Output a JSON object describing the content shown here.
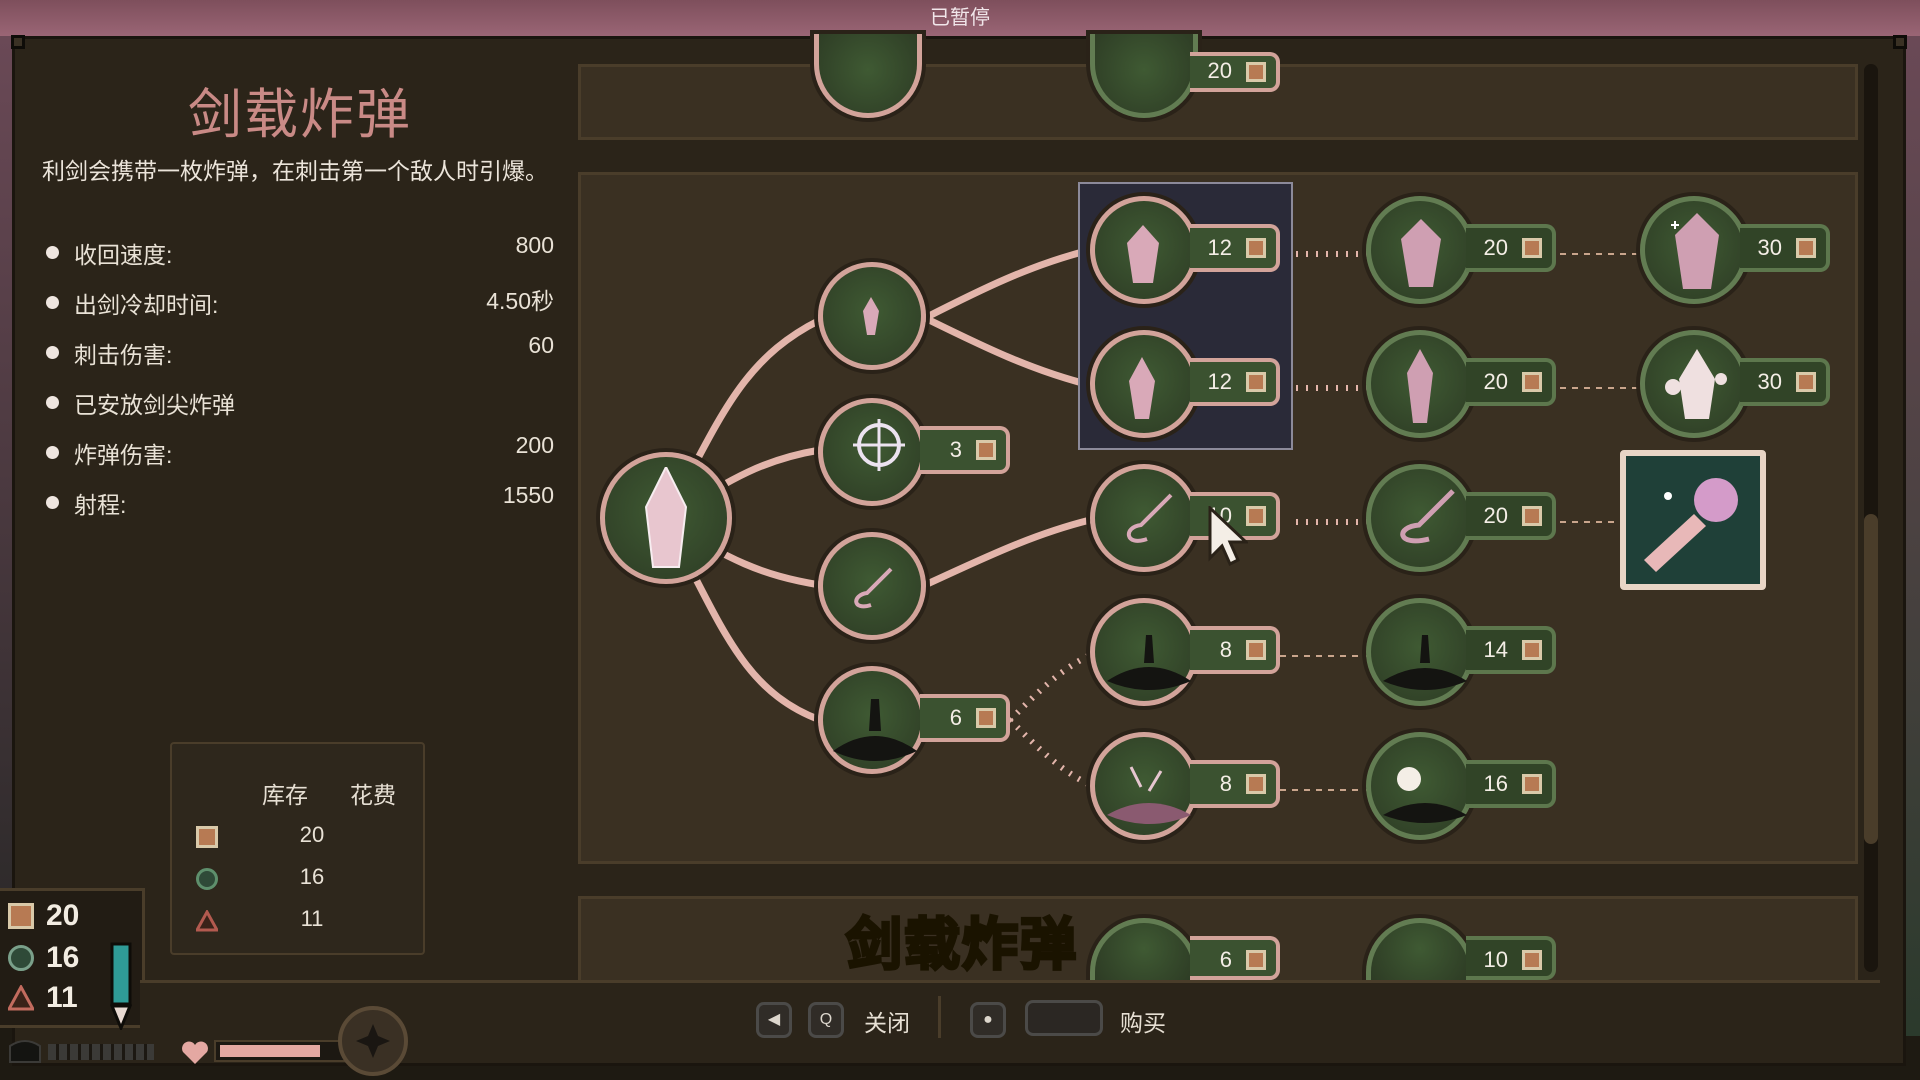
{
  "window": {
    "status": "已暂停"
  },
  "info": {
    "title": "剑载炸弹",
    "description": "利剑会携带一枚炸弹，在刺击第一个敌人时引爆。",
    "stats": [
      {
        "label": "收回速度:",
        "value": "800"
      },
      {
        "label": "出剑冷却时间:",
        "value": "4.50秒"
      },
      {
        "label": "刺击伤害:",
        "value": "60"
      },
      {
        "label": "已安放剑尖炸弹",
        "value": ""
      },
      {
        "label": "炸弹伤害:",
        "value": "200"
      },
      {
        "label": "射程:",
        "value": "1550"
      }
    ]
  },
  "inventory": {
    "header_stock": "库存",
    "header_cost": "花费",
    "rows": [
      {
        "icon": "gold-coin-icon",
        "stock": "20"
      },
      {
        "icon": "green-gear-icon",
        "stock": "16"
      },
      {
        "icon": "red-triangle-icon",
        "stock": "11"
      }
    ]
  },
  "resources": {
    "coins": "20",
    "gears": "16",
    "shards": "11"
  },
  "tree": {
    "top_partial_cost": "20",
    "nodes": [
      {
        "cost": "12"
      },
      {
        "cost": "20"
      },
      {
        "cost": "30"
      },
      {
        "cost": "12"
      },
      {
        "cost": "20"
      },
      {
        "cost": "30"
      },
      {
        "cost": "3"
      },
      {
        "cost": "10"
      },
      {
        "cost": "20"
      },
      {
        "cost": "8"
      },
      {
        "cost": "14"
      },
      {
        "cost": "6"
      },
      {
        "cost": "8"
      },
      {
        "cost": "16"
      }
    ],
    "bottom_costs": [
      "6",
      "10"
    ]
  },
  "caption": "剑载炸弹",
  "bottom": {
    "close_key": "Q",
    "close_label": "关闭",
    "buy_label": "购买"
  },
  "colors": {
    "accent": "#d2a39a",
    "node_green": "#3b5230",
    "caption": "#ffd200"
  }
}
